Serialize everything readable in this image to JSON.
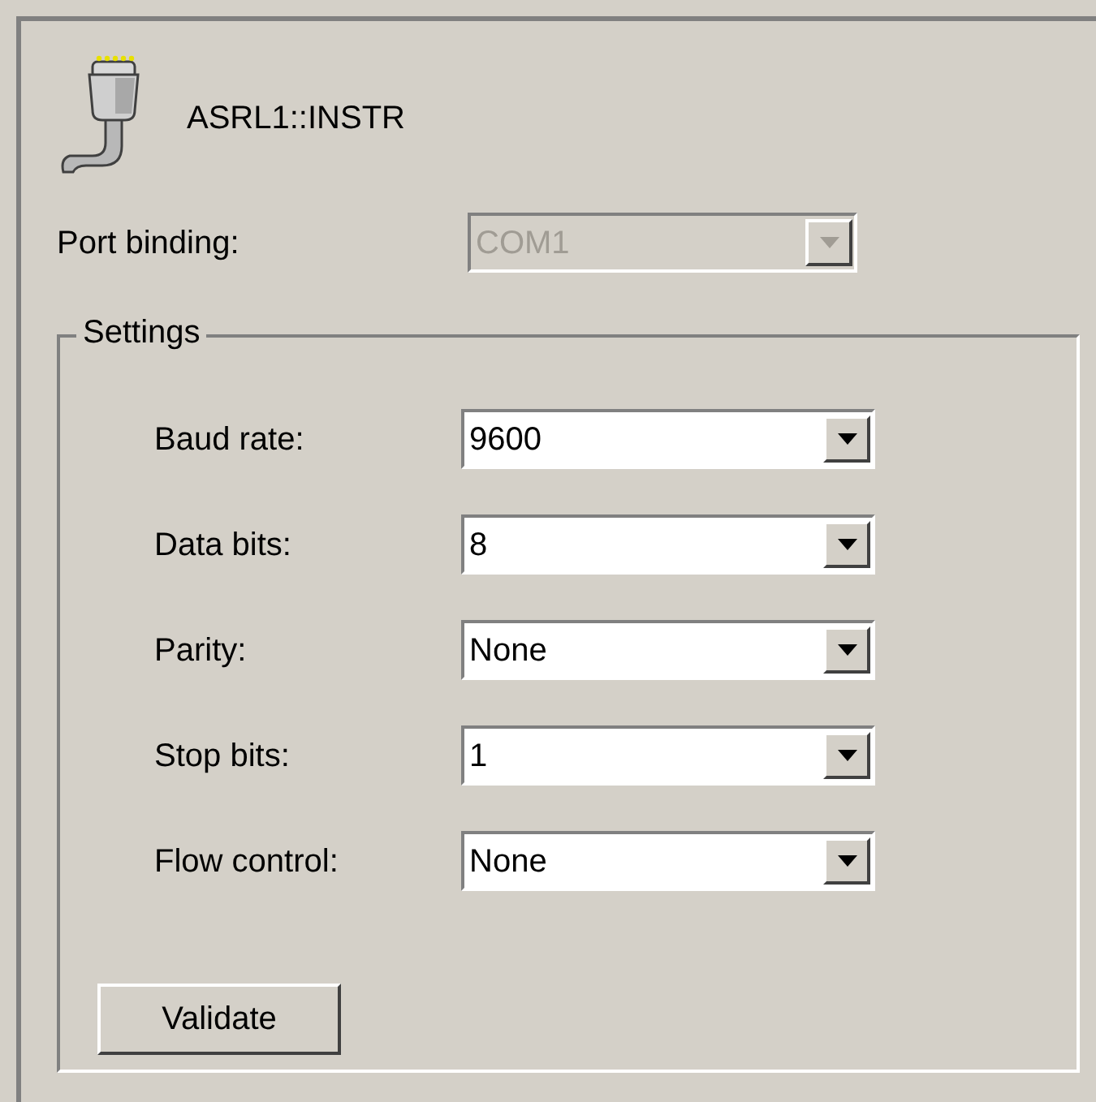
{
  "resource": {
    "name": "ASRL1::INSTR"
  },
  "port_binding": {
    "label": "Port binding:",
    "value": "COM1",
    "disabled": true
  },
  "settings": {
    "title": "Settings",
    "fields": [
      {
        "label": "Baud rate:",
        "value": "9600",
        "disabled": false
      },
      {
        "label": "Data bits:",
        "value": "8",
        "disabled": false
      },
      {
        "label": "Parity:",
        "value": "None",
        "disabled": false
      },
      {
        "label": "Stop bits:",
        "value": "1",
        "disabled": false
      },
      {
        "label": "Flow control:",
        "value": "None",
        "disabled": false
      }
    ],
    "button": "Validate"
  }
}
